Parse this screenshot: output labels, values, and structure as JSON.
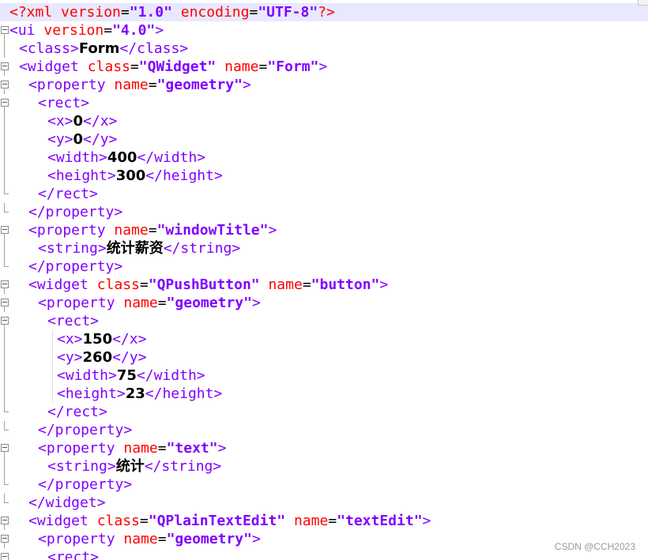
{
  "editor": {
    "lines": [
      [
        {
          "c": "decl",
          "t": "<?xml "
        },
        {
          "c": "attr",
          "t": "version"
        },
        {
          "c": "eq",
          "t": "="
        },
        {
          "c": "val",
          "t": "\"1.0\""
        },
        {
          "c": "attr",
          "t": " encoding"
        },
        {
          "c": "eq",
          "t": "="
        },
        {
          "c": "val",
          "t": "\"UTF-8\""
        },
        {
          "c": "decl",
          "t": "?>"
        }
      ],
      [
        {
          "c": "tag",
          "t": "<ui "
        },
        {
          "c": "attr",
          "t": "version"
        },
        {
          "c": "eq",
          "t": "="
        },
        {
          "c": "val",
          "t": "\"4.0\""
        },
        {
          "c": "tag",
          "t": ">"
        }
      ],
      [
        {
          "c": "tag",
          "t": "<class>"
        },
        {
          "c": "txt",
          "t": "Form"
        },
        {
          "c": "tag",
          "t": "</class>"
        }
      ],
      [
        {
          "c": "tag",
          "t": "<widget "
        },
        {
          "c": "attr",
          "t": "class"
        },
        {
          "c": "eq",
          "t": "="
        },
        {
          "c": "val",
          "t": "\"QWidget\""
        },
        {
          "c": "attr",
          "t": " name"
        },
        {
          "c": "eq",
          "t": "="
        },
        {
          "c": "val",
          "t": "\"Form\""
        },
        {
          "c": "tag",
          "t": ">"
        }
      ],
      [
        {
          "c": "tag",
          "t": "<property "
        },
        {
          "c": "attr",
          "t": "name"
        },
        {
          "c": "eq",
          "t": "="
        },
        {
          "c": "val",
          "t": "\"geometry\""
        },
        {
          "c": "tag",
          "t": ">"
        }
      ],
      [
        {
          "c": "tag",
          "t": "<rect>"
        }
      ],
      [
        {
          "c": "tag",
          "t": "<x>"
        },
        {
          "c": "txt",
          "t": "0"
        },
        {
          "c": "tag",
          "t": "</x>"
        }
      ],
      [
        {
          "c": "tag",
          "t": "<y>"
        },
        {
          "c": "txt",
          "t": "0"
        },
        {
          "c": "tag",
          "t": "</y>"
        }
      ],
      [
        {
          "c": "tag",
          "t": "<width>"
        },
        {
          "c": "txt",
          "t": "400"
        },
        {
          "c": "tag",
          "t": "</width>"
        }
      ],
      [
        {
          "c": "tag",
          "t": "<height>"
        },
        {
          "c": "txt",
          "t": "300"
        },
        {
          "c": "tag",
          "t": "</height>"
        }
      ],
      [
        {
          "c": "tag",
          "t": "</rect>"
        }
      ],
      [
        {
          "c": "tag",
          "t": "</property>"
        }
      ],
      [
        {
          "c": "tag",
          "t": "<property "
        },
        {
          "c": "attr",
          "t": "name"
        },
        {
          "c": "eq",
          "t": "="
        },
        {
          "c": "val",
          "t": "\"windowTitle\""
        },
        {
          "c": "tag",
          "t": ">"
        }
      ],
      [
        {
          "c": "tag",
          "t": "<string>"
        },
        {
          "c": "txt",
          "t": "统计薪资"
        },
        {
          "c": "tag",
          "t": "</string>"
        }
      ],
      [
        {
          "c": "tag",
          "t": "</property>"
        }
      ],
      [
        {
          "c": "tag",
          "t": "<widget "
        },
        {
          "c": "attr",
          "t": "class"
        },
        {
          "c": "eq",
          "t": "="
        },
        {
          "c": "val",
          "t": "\"QPushButton\""
        },
        {
          "c": "attr",
          "t": " name"
        },
        {
          "c": "eq",
          "t": "="
        },
        {
          "c": "val",
          "t": "\"button\""
        },
        {
          "c": "tag",
          "t": ">"
        }
      ],
      [
        {
          "c": "tag",
          "t": "<property "
        },
        {
          "c": "attr",
          "t": "name"
        },
        {
          "c": "eq",
          "t": "="
        },
        {
          "c": "val",
          "t": "\"geometry\""
        },
        {
          "c": "tag",
          "t": ">"
        }
      ],
      [
        {
          "c": "tag",
          "t": "<rect>"
        }
      ],
      [
        {
          "c": "tag",
          "t": "<x>"
        },
        {
          "c": "txt",
          "t": "150"
        },
        {
          "c": "tag",
          "t": "</x>"
        }
      ],
      [
        {
          "c": "tag",
          "t": "<y>"
        },
        {
          "c": "txt",
          "t": "260"
        },
        {
          "c": "tag",
          "t": "</y>"
        }
      ],
      [
        {
          "c": "tag",
          "t": "<width>"
        },
        {
          "c": "txt",
          "t": "75"
        },
        {
          "c": "tag",
          "t": "</width>"
        }
      ],
      [
        {
          "c": "tag",
          "t": "<height>"
        },
        {
          "c": "txt",
          "t": "23"
        },
        {
          "c": "tag",
          "t": "</height>"
        }
      ],
      [
        {
          "c": "tag",
          "t": "</rect>"
        }
      ],
      [
        {
          "c": "tag",
          "t": "</property>"
        }
      ],
      [
        {
          "c": "tag",
          "t": "<property "
        },
        {
          "c": "attr",
          "t": "name"
        },
        {
          "c": "eq",
          "t": "="
        },
        {
          "c": "val",
          "t": "\"text\""
        },
        {
          "c": "tag",
          "t": ">"
        }
      ],
      [
        {
          "c": "tag",
          "t": "<string>"
        },
        {
          "c": "txt",
          "t": "统计"
        },
        {
          "c": "tag",
          "t": "</string>"
        }
      ],
      [
        {
          "c": "tag",
          "t": "</property>"
        }
      ],
      [
        {
          "c": "tag",
          "t": "</widget>"
        }
      ],
      [
        {
          "c": "tag",
          "t": "<widget "
        },
        {
          "c": "attr",
          "t": "class"
        },
        {
          "c": "eq",
          "t": "="
        },
        {
          "c": "val",
          "t": "\"QPlainTextEdit\""
        },
        {
          "c": "attr",
          "t": " name"
        },
        {
          "c": "eq",
          "t": "="
        },
        {
          "c": "val",
          "t": "\"textEdit\""
        },
        {
          "c": "tag",
          "t": ">"
        }
      ],
      [
        {
          "c": "tag",
          "t": "<property "
        },
        {
          "c": "attr",
          "t": "name"
        },
        {
          "c": "eq",
          "t": "="
        },
        {
          "c": "val",
          "t": "\"geometry\""
        },
        {
          "c": "tag",
          "t": ">"
        }
      ],
      [
        {
          "c": "tag",
          "t": "<rect>"
        }
      ]
    ]
  },
  "watermark": "CSDN @CCH2023",
  "colors": {
    "tag": "#8000ff",
    "attribute": "#ff0000",
    "value": "#8000ff",
    "current_line": "#e8e8ff"
  }
}
